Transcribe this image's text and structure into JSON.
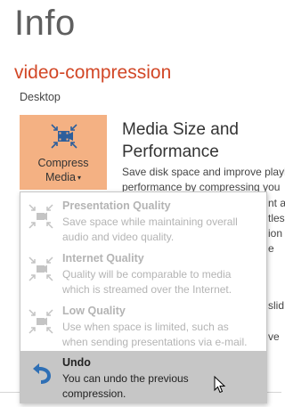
{
  "header": {
    "title": "Info"
  },
  "document": {
    "name": "video-compression",
    "location": "Desktop"
  },
  "compress_button": {
    "line1": "Compress",
    "line2": "Media",
    "caret": "▾",
    "icon": "film-compress-icon"
  },
  "section": {
    "title_line1": "Media Size and",
    "title_line2": "Performance",
    "desc_line1": "Save disk space and improve playb",
    "desc_line2": "performance by compressing you"
  },
  "background_peek": {
    "p1": "nt at",
    "p2": "tles",
    "p3": "ion",
    "p4": "e",
    "p5": "slid",
    "p6": "ve"
  },
  "menu": {
    "items": [
      {
        "title": "Presentation Quality",
        "desc_line1": "Save space while maintaining overall",
        "desc_line2": "audio and video quality.",
        "icon": "compress-arrows-icon"
      },
      {
        "title": "Internet Quality",
        "desc_line1": "Quality will be comparable to media",
        "desc_line2": "which is streamed over the Internet.",
        "icon": "compress-arrows-icon"
      },
      {
        "title": "Low Quality",
        "desc_line1": "Use when space is limited, such as",
        "desc_line2": "when sending presentations via e-mail.",
        "icon": "compress-arrows-icon"
      },
      {
        "title": "Undo",
        "desc_line1": "You can undo the previous",
        "desc_line2": "compression.",
        "icon": "undo-arrow-icon"
      }
    ]
  },
  "colors": {
    "accent": "#d24726",
    "button_bg": "#f4b183",
    "undo_icon": "#2e6fb5",
    "hover_bg": "#c6c6c6",
    "disabled_text": "#b4b4b4"
  }
}
